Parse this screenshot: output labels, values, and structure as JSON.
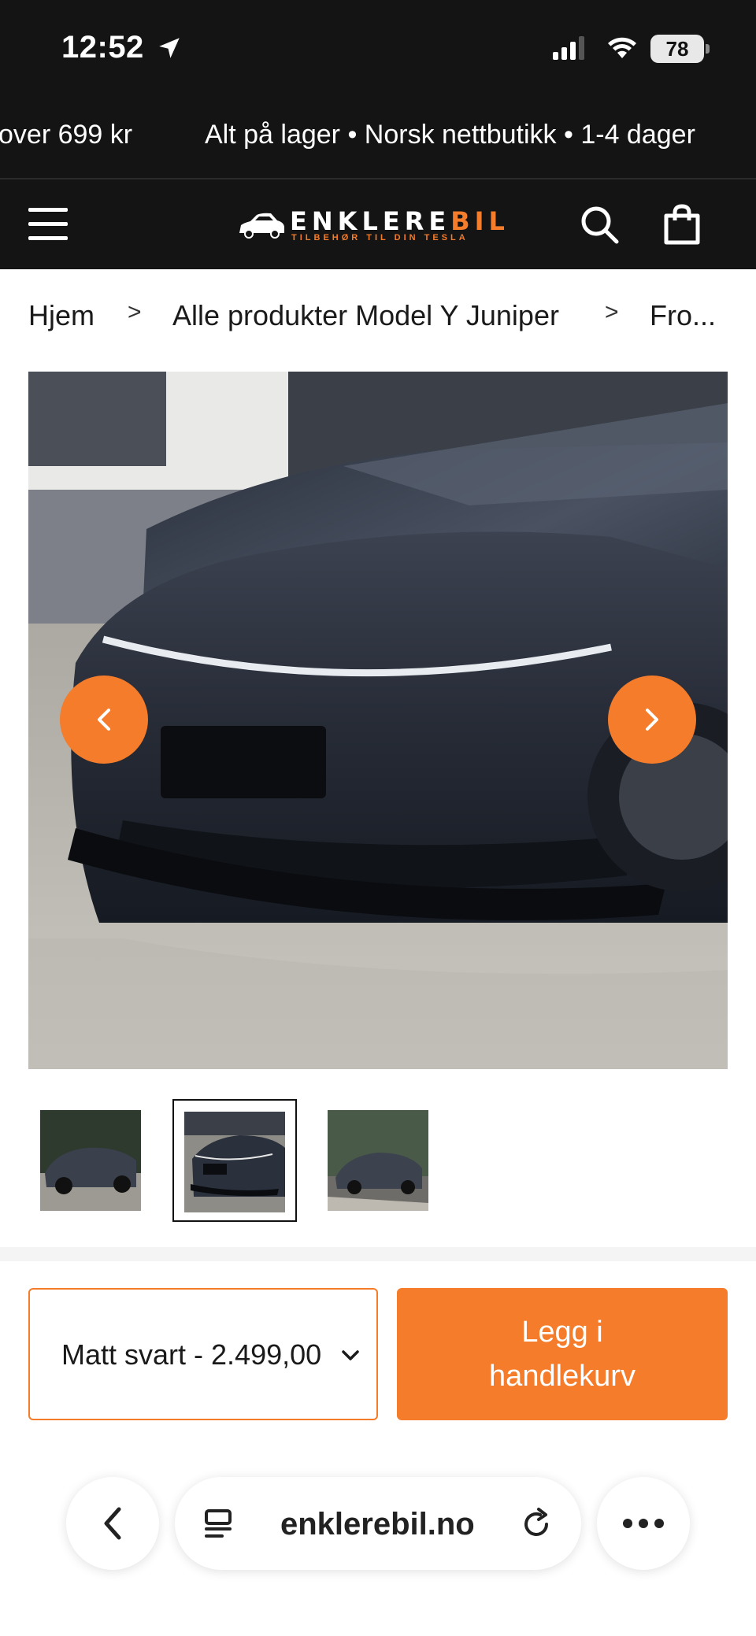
{
  "status_bar": {
    "time": "12:52",
    "battery": "78"
  },
  "ticker": {
    "items": [
      "over 699 kr",
      "Alt på lager • Norsk nettbutikk • 1-4 dager"
    ]
  },
  "header": {
    "logo_word_main": "ENKLERE",
    "logo_word_accent": "BIL",
    "logo_tagline": "TILBEHØR TIL DIN TESLA"
  },
  "breadcrumb": {
    "items": [
      "Hjem",
      "Alle produkter Model Y Juniper",
      "Fro..."
    ],
    "separator": ">"
  },
  "gallery": {
    "image_count": 3,
    "selected_index": 1
  },
  "purchase": {
    "variant_value": "Matt svart - 2.499,00",
    "add_to_cart_line1": "Legg i",
    "add_to_cart_line2": "handlekurv"
  },
  "browser": {
    "url": "enklerebil.no"
  },
  "colors": {
    "accent": "#f47c2a",
    "dark": "#141414"
  }
}
